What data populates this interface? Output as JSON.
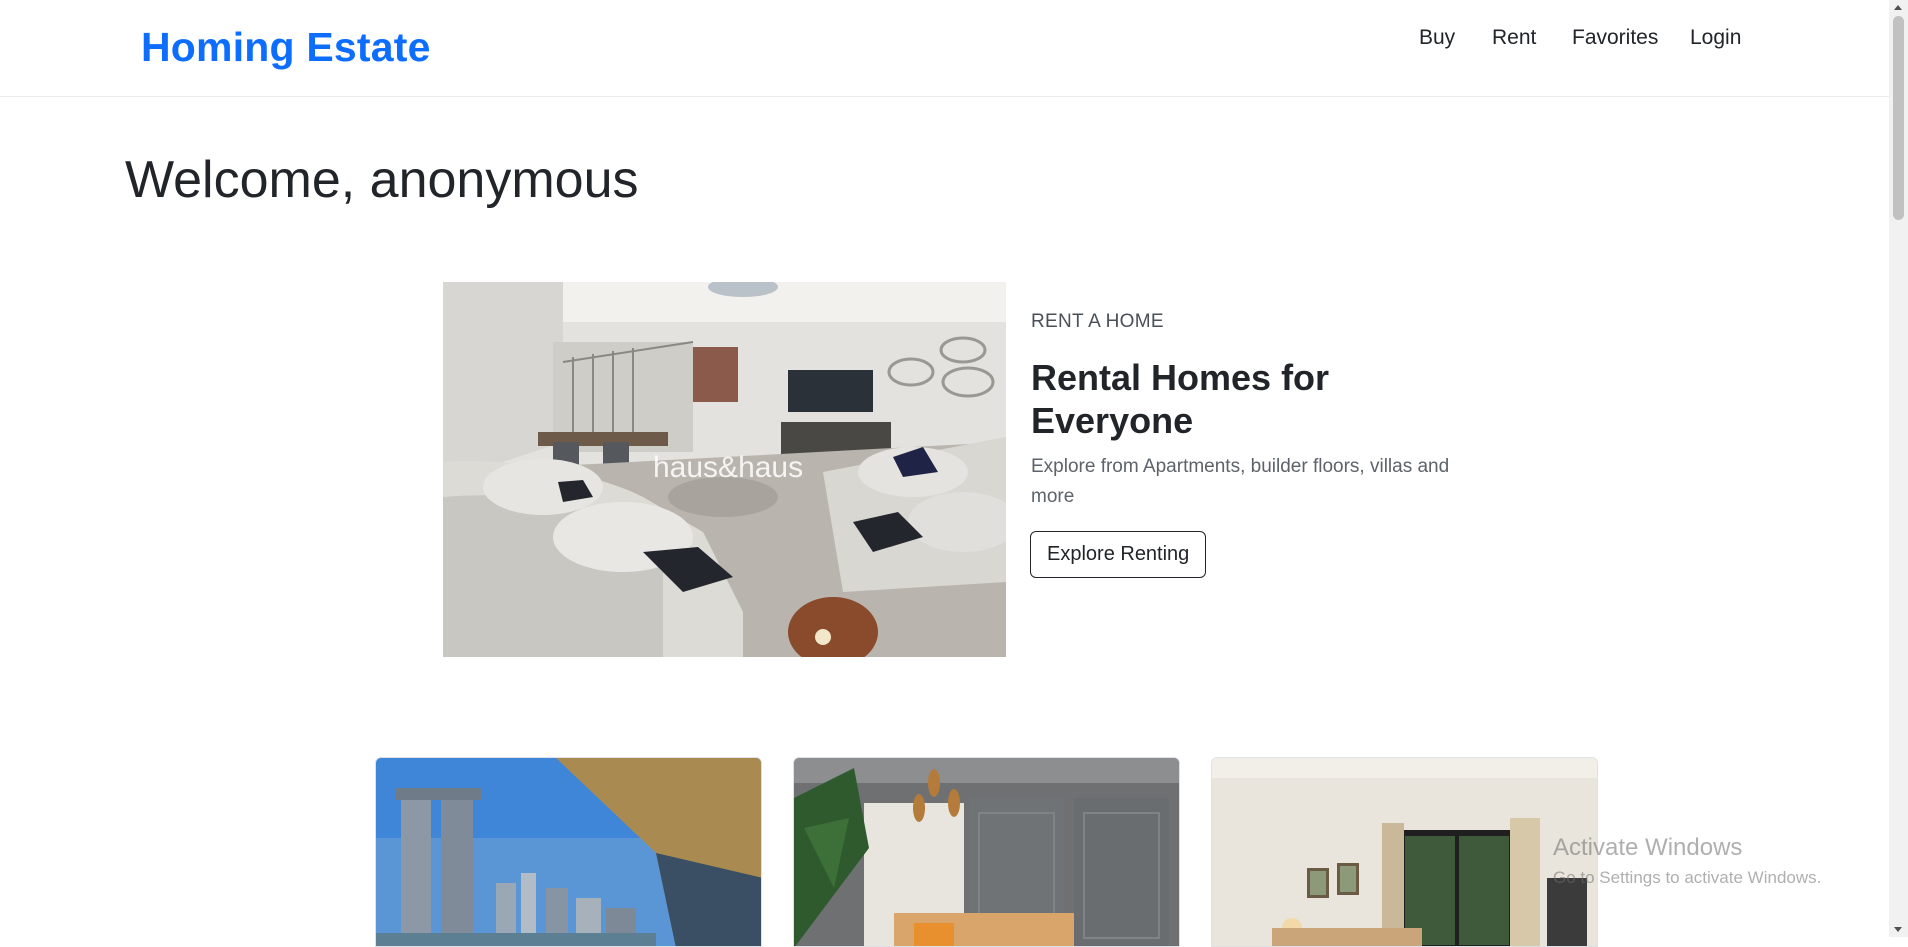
{
  "navbar": {
    "brand": "Homing Estate",
    "links": [
      "Buy",
      "Rent",
      "Favorites",
      "Login"
    ]
  },
  "welcome": {
    "title": "Welcome, anonymous"
  },
  "hero": {
    "image_watermark": "haus&haus",
    "eyebrow": "RENT A HOME",
    "title": "Rental Homes for Everyone",
    "description": "Explore from Apartments, builder floors, villas and more",
    "button_label": "Explore Renting"
  },
  "cards": [
    {
      "image": "balcony-city-view"
    },
    {
      "image": "modern-living-room"
    },
    {
      "image": "bedroom-with-window"
    }
  ],
  "watermark": {
    "title": "Activate Windows",
    "subtitle": "Go to Settings to activate Windows."
  },
  "colors": {
    "brand": "#0d6efd",
    "text": "#212529",
    "muted": "#5c636a"
  }
}
